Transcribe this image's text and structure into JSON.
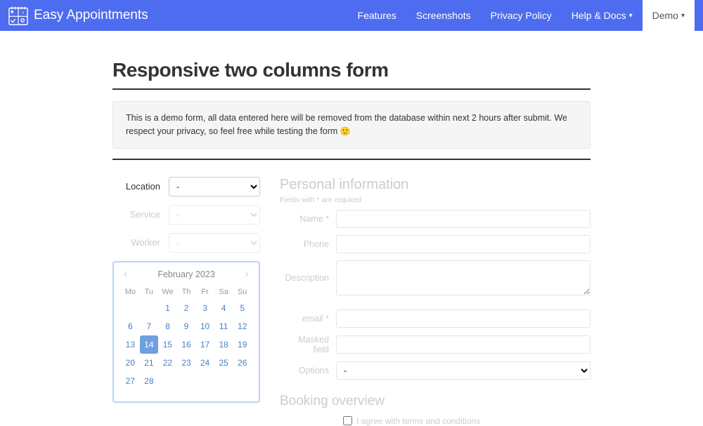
{
  "nav": {
    "brand": "Easy Appointments",
    "links": [
      "Features",
      "Screenshots",
      "Privacy Policy",
      "Help & Docs"
    ],
    "demo": "Demo"
  },
  "page": {
    "title": "Responsive two columns form",
    "notice": "This is a demo form, all data entered here will be removed from the database within next 2 hours after submit. We respect your privacy, so feel free while testing the form",
    "emoji": "🙂"
  },
  "form_left": {
    "location_label": "Location",
    "service_label": "Service",
    "worker_label": "Worker",
    "dash": "-"
  },
  "calendar": {
    "title": "February 2023",
    "dows": [
      "Mo",
      "Tu",
      "We",
      "Th",
      "Fr",
      "Sa",
      "Su"
    ],
    "weeks": [
      [
        "",
        "",
        "1",
        "2",
        "3",
        "4",
        "5"
      ],
      [
        "6",
        "7",
        "8",
        "9",
        "10",
        "11",
        "12"
      ],
      [
        "13",
        "14",
        "15",
        "16",
        "17",
        "18",
        "19"
      ],
      [
        "20",
        "21",
        "22",
        "23",
        "24",
        "25",
        "26"
      ],
      [
        "27",
        "28",
        "",
        "",
        "",
        "",
        ""
      ]
    ],
    "selected": "14"
  },
  "personal": {
    "heading": "Personal information",
    "subnote": "Fields with * are required",
    "name_label": "Name *",
    "phone_label": "Phone",
    "desc_label": "Description",
    "email_label": "email *",
    "masked_label": "Masked field",
    "options_label": "Options",
    "options_dash": "-",
    "terms": "I agree with terms and conditions"
  },
  "overview": {
    "heading": "Booking overview"
  }
}
